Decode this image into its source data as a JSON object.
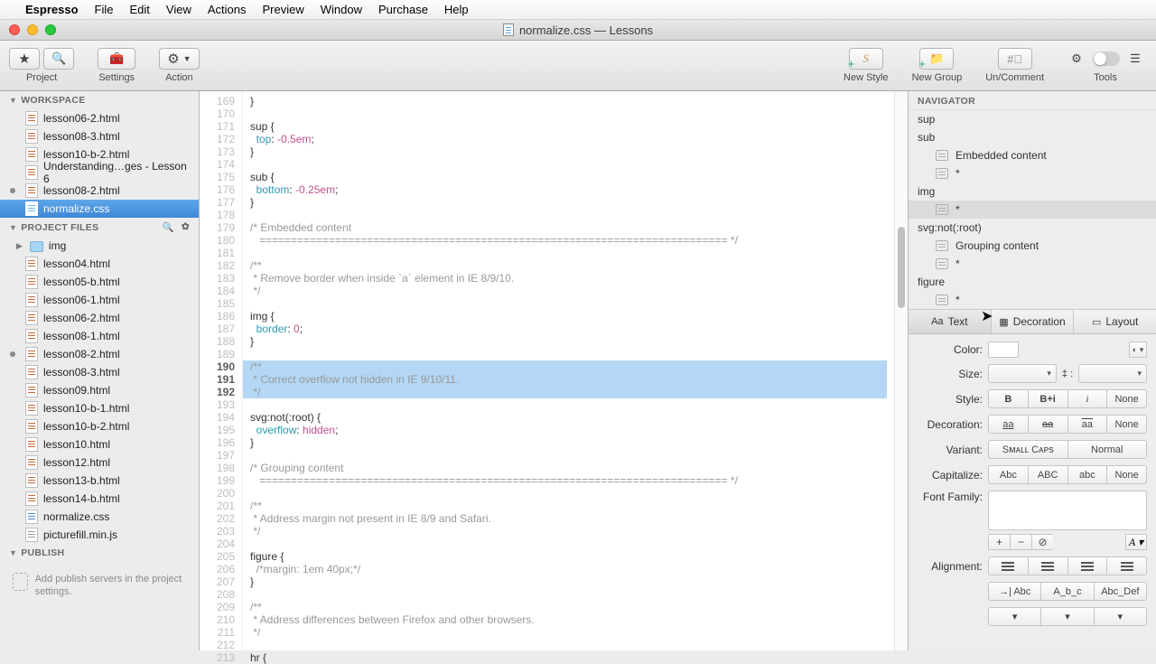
{
  "menubar": {
    "app": "Espresso",
    "items": [
      "File",
      "Edit",
      "View",
      "Actions",
      "Preview",
      "Window",
      "Purchase",
      "Help"
    ]
  },
  "window": {
    "title": "normalize.css — Lessons"
  },
  "toolbar": {
    "project": "Project",
    "settings": "Settings",
    "action": "Action",
    "new_style": "New Style",
    "new_group": "New Group",
    "uncomment": "Un/Comment",
    "tools": "Tools"
  },
  "sidebar": {
    "workspace_h": "WORKSPACE",
    "workspace": [
      {
        "name": "lesson06-2.html",
        "kind": "html"
      },
      {
        "name": "lesson08-3.html",
        "kind": "html"
      },
      {
        "name": "lesson10-b-2.html",
        "kind": "html"
      },
      {
        "name": "Understanding…ges - Lesson 6",
        "kind": "html"
      },
      {
        "name": "lesson08-2.html",
        "kind": "html",
        "dot": true
      },
      {
        "name": "normalize.css",
        "kind": "css",
        "sel": true
      }
    ],
    "projectfiles_h": "PROJECT FILES",
    "project": [
      {
        "name": "img",
        "kind": "folder"
      },
      {
        "name": "lesson04.html",
        "kind": "html"
      },
      {
        "name": "lesson05-b.html",
        "kind": "html"
      },
      {
        "name": "lesson06-1.html",
        "kind": "html"
      },
      {
        "name": "lesson06-2.html",
        "kind": "html"
      },
      {
        "name": "lesson08-1.html",
        "kind": "html"
      },
      {
        "name": "lesson08-2.html",
        "kind": "html",
        "dot": true
      },
      {
        "name": "lesson08-3.html",
        "kind": "html"
      },
      {
        "name": "lesson09.html",
        "kind": "html"
      },
      {
        "name": "lesson10-b-1.html",
        "kind": "html"
      },
      {
        "name": "lesson10-b-2.html",
        "kind": "html"
      },
      {
        "name": "lesson10.html",
        "kind": "html"
      },
      {
        "name": "lesson12.html",
        "kind": "html"
      },
      {
        "name": "lesson13-b.html",
        "kind": "html"
      },
      {
        "name": "lesson14-b.html",
        "kind": "html"
      },
      {
        "name": "normalize.css",
        "kind": "css"
      },
      {
        "name": "picturefill.min.js",
        "kind": "js"
      }
    ],
    "publish_h": "PUBLISH",
    "publish_hint": "Add publish servers in the project settings."
  },
  "editor": {
    "first_line_no": 169,
    "highlight_start": 190,
    "highlight_end": 192,
    "lines": [
      {
        "t": "}",
        "cls": ""
      },
      {
        "t": "",
        "cls": ""
      },
      {
        "t": "sup {",
        "cls": "sel-c"
      },
      {
        "t": "  top: -0.5em;",
        "prop": "top",
        "val": "-0.5",
        "unit": "em"
      },
      {
        "t": "}",
        "cls": ""
      },
      {
        "t": "",
        "cls": ""
      },
      {
        "t": "sub {",
        "cls": "sel-c"
      },
      {
        "t": "  bottom: -0.25em;",
        "prop": "bottom",
        "val": "-0.25",
        "unit": "em"
      },
      {
        "t": "}",
        "cls": ""
      },
      {
        "t": "",
        "cls": ""
      },
      {
        "t": "/* Embedded content",
        "cls": "cm"
      },
      {
        "t": "   ========================================================================== */",
        "cls": "cm"
      },
      {
        "t": "",
        "cls": ""
      },
      {
        "t": "/**",
        "cls": "cm"
      },
      {
        "t": " * Remove border when inside `a` element in IE 8/9/10.",
        "cls": "cm"
      },
      {
        "t": " */",
        "cls": "cm"
      },
      {
        "t": "",
        "cls": ""
      },
      {
        "t": "img {",
        "cls": "sel-c"
      },
      {
        "t": "  border: 0;",
        "prop": "border",
        "val": "0"
      },
      {
        "t": "}",
        "cls": ""
      },
      {
        "t": "",
        "cls": ""
      },
      {
        "t": "/**",
        "cls": "cm"
      },
      {
        "t": " * Correct overflow not hidden in IE 9/10/11.",
        "cls": "cm"
      },
      {
        "t": " */",
        "cls": "cm"
      },
      {
        "t": "",
        "cls": ""
      },
      {
        "t": "svg:not(:root) {",
        "cls": "sel-c"
      },
      {
        "t": "  overflow: hidden;",
        "prop": "overflow",
        "val": "hidden"
      },
      {
        "t": "}",
        "cls": ""
      },
      {
        "t": "",
        "cls": ""
      },
      {
        "t": "/* Grouping content",
        "cls": "cm"
      },
      {
        "t": "   ========================================================================== */",
        "cls": "cm"
      },
      {
        "t": "",
        "cls": ""
      },
      {
        "t": "/**",
        "cls": "cm"
      },
      {
        "t": " * Address margin not present in IE 8/9 and Safari.",
        "cls": "cm"
      },
      {
        "t": " */",
        "cls": "cm"
      },
      {
        "t": "",
        "cls": ""
      },
      {
        "t": "figure {",
        "cls": "sel-c"
      },
      {
        "t": "  /*margin: 1em 40px;*/",
        "cls": "cm"
      },
      {
        "t": "}",
        "cls": ""
      },
      {
        "t": "",
        "cls": ""
      },
      {
        "t": "/**",
        "cls": "cm"
      },
      {
        "t": " * Address differences between Firefox and other browsers.",
        "cls": "cm"
      },
      {
        "t": " */",
        "cls": "cm"
      },
      {
        "t": "",
        "cls": ""
      },
      {
        "t": "hr {",
        "cls": "sel-c"
      }
    ]
  },
  "navigator": {
    "header": "NAVIGATOR",
    "items": [
      {
        "label": "sup",
        "icon": false
      },
      {
        "label": "sub",
        "icon": false
      },
      {
        "label": "Embedded content",
        "icon": true,
        "indent": true
      },
      {
        "label": "*",
        "icon": true,
        "indent": true
      },
      {
        "label": "img",
        "icon": false
      },
      {
        "label": "*",
        "icon": true,
        "indent": true,
        "sel": true
      },
      {
        "label": "svg:not(:root)",
        "icon": false
      },
      {
        "label": "Grouping content",
        "icon": true,
        "indent": true
      },
      {
        "label": "*",
        "icon": true,
        "indent": true
      },
      {
        "label": "figure",
        "icon": false
      },
      {
        "label": "*",
        "icon": true,
        "indent": true
      }
    ]
  },
  "inspector": {
    "tabs": {
      "text": "Text",
      "decoration": "Decoration",
      "layout": "Layout"
    },
    "labels": {
      "color": "Color:",
      "size": "Size:",
      "style": "Style:",
      "decoration": "Decoration:",
      "variant": "Variant:",
      "capitalize": "Capitalize:",
      "fontfamily": "Font Family:",
      "alignment": "Alignment:"
    },
    "style_opts": [
      "B",
      "B+i",
      "i",
      "None"
    ],
    "deco_opts": [
      "aa",
      "aa",
      "aa",
      "None"
    ],
    "variant_opts": [
      "Sᴍᴀʟʟ Cᴀᴘs",
      "Normal"
    ],
    "cap_opts": [
      "Abc",
      "ABC",
      "abc",
      "None"
    ],
    "indent_opts": [
      "→| Abc",
      "A_b_c",
      "Abc_Def"
    ]
  }
}
